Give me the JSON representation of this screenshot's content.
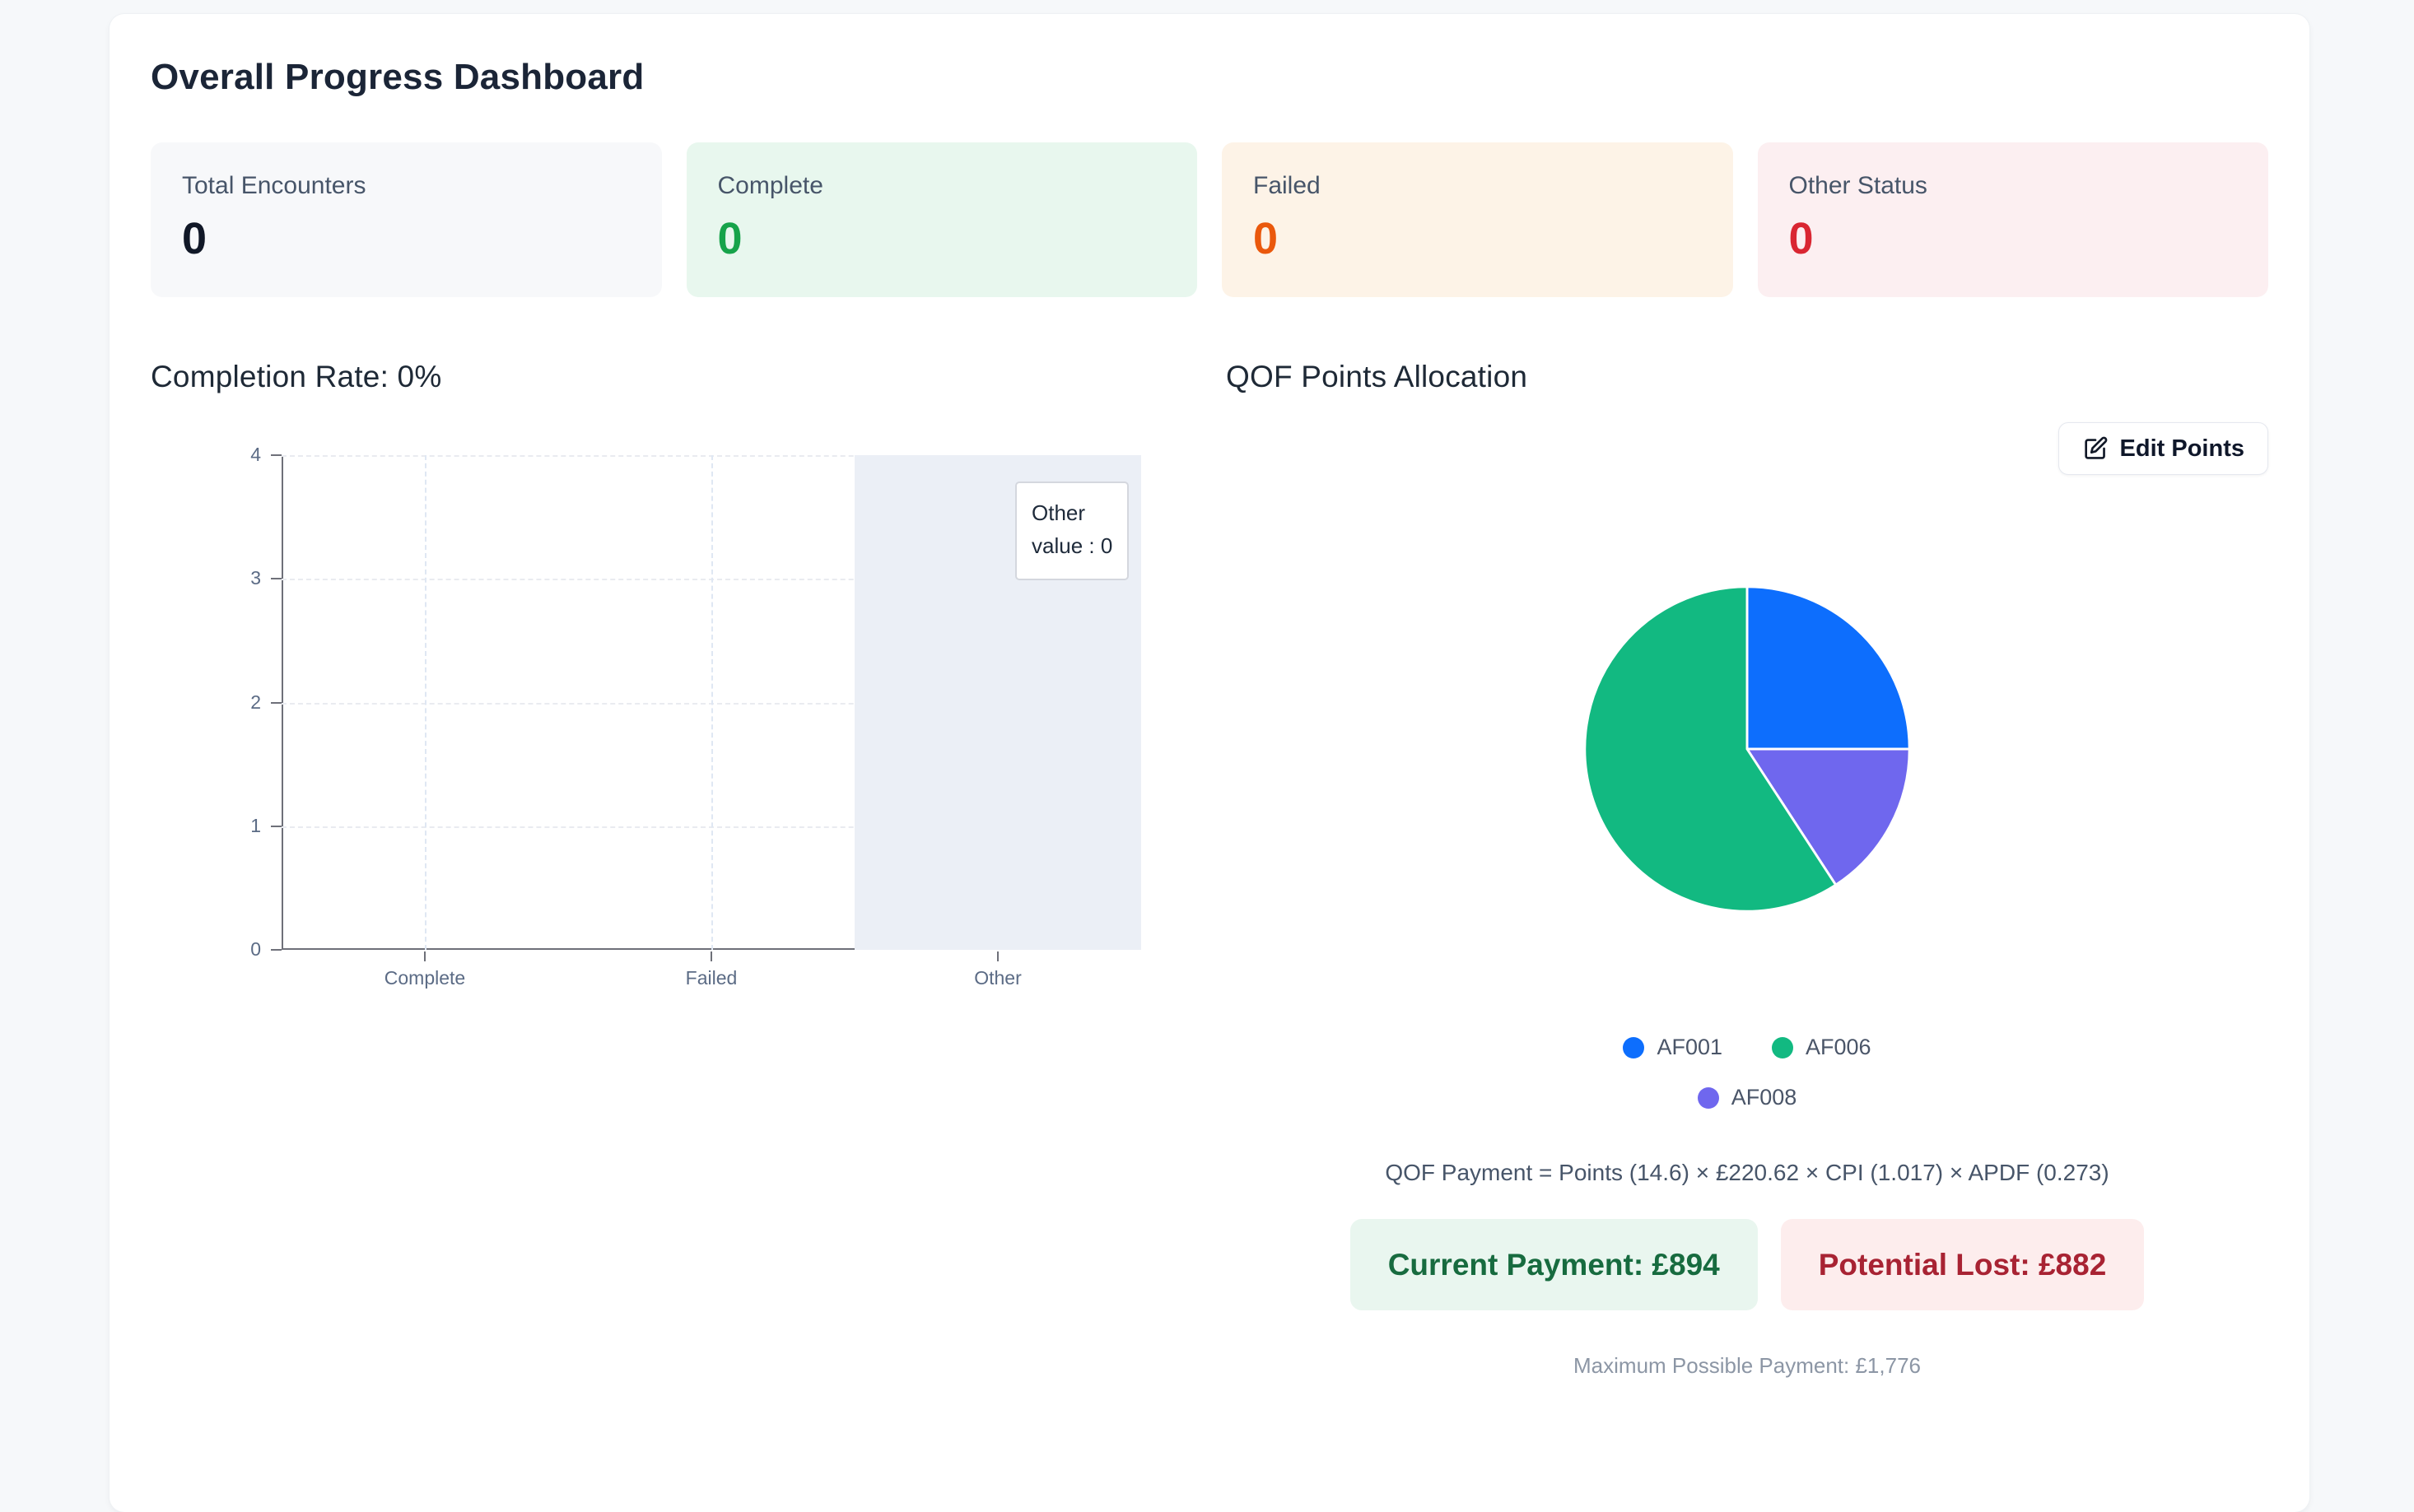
{
  "page": {
    "title": "Overall Progress Dashboard"
  },
  "stats": [
    {
      "label": "Total Encounters",
      "value": "0",
      "bg": "#f7f8fa",
      "value_color": "#111827"
    },
    {
      "label": "Complete",
      "value": "0",
      "bg": "#e8f7ee",
      "value_color": "#16a34a"
    },
    {
      "label": "Failed",
      "value": "0",
      "bg": "#fdf3e7",
      "value_color": "#ea580c"
    },
    {
      "label": "Other Status",
      "value": "0",
      "bg": "#fceff1",
      "value_color": "#d92632"
    }
  ],
  "completion": {
    "heading": "Completion Rate: 0%"
  },
  "chart_data": [
    {
      "type": "bar",
      "title": "Completion Rate: 0%",
      "categories": [
        "Complete",
        "Failed",
        "Other"
      ],
      "values": [
        0,
        0,
        0
      ],
      "ylim": [
        0,
        4
      ],
      "yticks": [
        0,
        1,
        2,
        3,
        4
      ],
      "grid": true,
      "highlight": {
        "category": "Other",
        "band_color": "#ebeff6"
      },
      "tooltip": {
        "title": "Other",
        "text": "value : 0"
      },
      "axis_color": "#6E7079",
      "label_color": "#5b6b85"
    },
    {
      "type": "pie",
      "title": "QOF Points Allocation",
      "slices": [
        {
          "label": "AF001",
          "percent": 25.0,
          "color": "#0d6efd"
        },
        {
          "label": "AF008",
          "percent": 15.8,
          "color": "#6f67ee"
        },
        {
          "label": "AF006",
          "percent": 59.2,
          "color": "#12b981"
        }
      ],
      "draw_order": "clockwise from 12 o'clock: AF001, AF008, AF006",
      "legend_position": "bottom",
      "legend_rows": [
        [
          "AF001",
          "AF006"
        ],
        [
          "AF008"
        ]
      ]
    }
  ],
  "qof": {
    "heading": "QOF Points Allocation",
    "edit_button_label": "Edit Points",
    "formula": "QOF Payment = Points (14.6) × £220.62 × CPI (1.017) × APDF (0.273)",
    "current_payment": "Current Payment: £894",
    "potential_lost": "Potential Lost: £882",
    "max_payment": "Maximum Possible Payment: £1,776",
    "colors": {
      "current_bg": "#e9f6ef",
      "current_text": "#176b3f",
      "lost_bg": "#fdeded",
      "lost_text": "#a82333"
    }
  }
}
